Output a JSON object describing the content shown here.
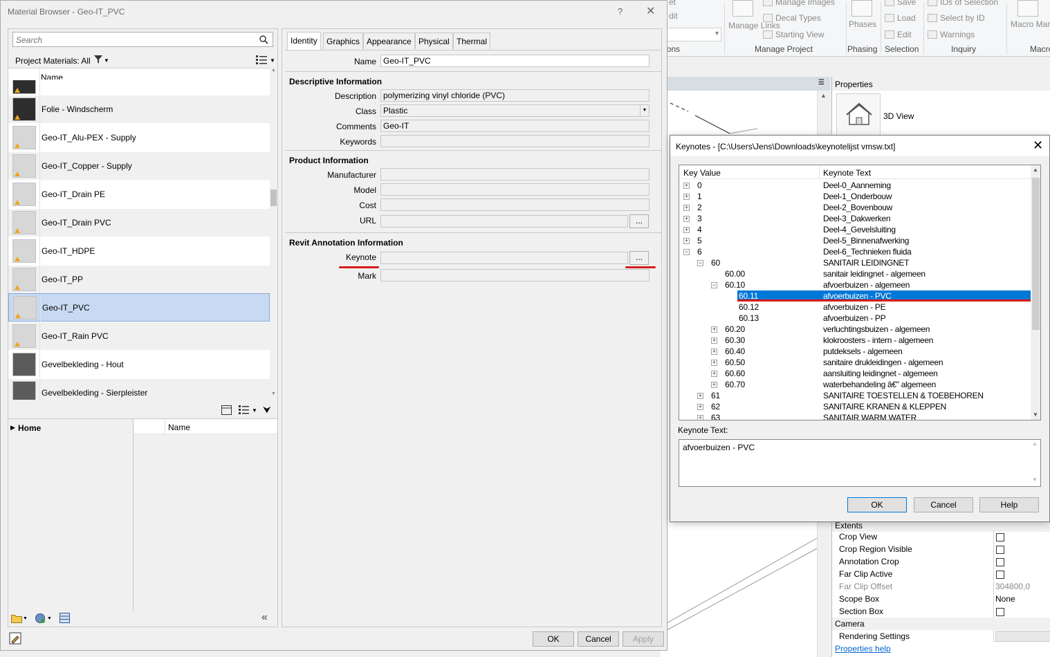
{
  "revit": {
    "ribbon": {
      "items": [
        "Save",
        "Load",
        "Edit",
        "Manage Images",
        "Decal Types",
        "Starting View",
        "IDs of Selection",
        "Select by ID",
        "Warnings",
        "Phases",
        "Manage Links",
        "Macro Manager"
      ],
      "groups": [
        "ions",
        "Manage Project",
        "Phasing",
        "Selection",
        "Inquiry",
        "Macro"
      ],
      "left_fragment": [
        "et",
        "dit"
      ]
    },
    "properties": {
      "title": "Properties",
      "type_name": "3D View",
      "categories": [
        "Extents",
        "Camera"
      ],
      "rows": [
        {
          "name": "Crop View",
          "checkbox": true
        },
        {
          "name": "Crop Region Visible",
          "checkbox": true
        },
        {
          "name": "Annotation Crop",
          "checkbox": true
        },
        {
          "name": "Far Clip Active",
          "checkbox": true
        },
        {
          "name": "Far Clip Offset",
          "value": "304800,0"
        },
        {
          "name": "Scope Box",
          "value": "None"
        },
        {
          "name": "Section Box",
          "checkbox": true
        },
        {
          "name": "Rendering Settings"
        }
      ],
      "help_link": "Properties help"
    }
  },
  "material_browser": {
    "title": "Material Browser - Geo-IT_PVC",
    "help": "?",
    "close": "✕",
    "search_placeholder": "Search",
    "filter_label": "Project Materials: All",
    "list_header": "Name",
    "materials": [
      {
        "name": "",
        "thumb": "dark"
      },
      {
        "name": "Folie - Windscherm",
        "thumb": "dark"
      },
      {
        "name": "Geo-IT_Alu-PEX - Supply",
        "thumb": "grey"
      },
      {
        "name": "Geo-IT_Copper - Supply",
        "thumb": "grey"
      },
      {
        "name": "Geo-IT_Drain PE",
        "thumb": "grey"
      },
      {
        "name": "Geo-IT_Drain PVC",
        "thumb": "grey"
      },
      {
        "name": "Geo-IT_HDPE",
        "thumb": "grey"
      },
      {
        "name": "Geo-IT_PP",
        "thumb": "grey"
      },
      {
        "name": "Geo-IT_PVC",
        "thumb": "grey",
        "selected": true
      },
      {
        "name": "Geo-IT_Rain PVC",
        "thumb": "grey"
      },
      {
        "name": "Gevelbekleding - Hout",
        "thumb": "tex"
      },
      {
        "name": "Gevelbekleding - Sierpleister",
        "thumb": "tex"
      }
    ],
    "library": {
      "tree_root": "Home",
      "list_header": "Name"
    },
    "tabs": [
      "Identity",
      "Graphics",
      "Appearance",
      "Physical",
      "Thermal"
    ],
    "active_tab": "Identity",
    "fields": {
      "name": {
        "label": "Name",
        "value": "Geo-IT_PVC"
      },
      "descriptive_header": "Descriptive Information",
      "description": {
        "label": "Description",
        "value": "polymerizing vinyl chloride (PVC)"
      },
      "class": {
        "label": "Class",
        "value": "Plastic"
      },
      "comments": {
        "label": "Comments",
        "value": "Geo-IT"
      },
      "keywords": {
        "label": "Keywords",
        "value": ""
      },
      "product_header": "Product Information",
      "manufacturer": {
        "label": "Manufacturer",
        "value": ""
      },
      "model": {
        "label": "Model",
        "value": ""
      },
      "cost": {
        "label": "Cost",
        "value": ""
      },
      "url": {
        "label": "URL",
        "value": ""
      },
      "revit_header": "Revit Annotation Information",
      "keynote": {
        "label": "Keynote",
        "value": ""
      },
      "mark": {
        "label": "Mark",
        "value": ""
      }
    },
    "browse_button": "...",
    "buttons": {
      "ok": "OK",
      "cancel": "Cancel",
      "apply": "Apply"
    }
  },
  "keynotes": {
    "title": "Keynotes - [C:\\Users\\Jens\\Downloads\\keynotelijst vmsw.txt]",
    "close": "✕",
    "col_key": "Key Value",
    "col_text": "Keynote Text",
    "rows": [
      {
        "key": "0",
        "text": "Deel-0_Aanneming",
        "level": 0,
        "exp": "+"
      },
      {
        "key": "1",
        "text": "Deel-1_Onderbouw",
        "level": 0,
        "exp": "+"
      },
      {
        "key": "2",
        "text": "Deel-2_Bovenbouw",
        "level": 0,
        "exp": "+"
      },
      {
        "key": "3",
        "text": "Deel-3_Dakwerken",
        "level": 0,
        "exp": "+"
      },
      {
        "key": "4",
        "text": "Deel-4_Gevelsluiting",
        "level": 0,
        "exp": "+"
      },
      {
        "key": "5",
        "text": "Deel-5_Binnenafwerking",
        "level": 0,
        "exp": "+"
      },
      {
        "key": "6",
        "text": "Deel-6_Technieken fluida",
        "level": 0,
        "exp": "−"
      },
      {
        "key": "60",
        "text": "SANITAIR LEIDINGNET",
        "level": 1,
        "exp": "−"
      },
      {
        "key": "60.00",
        "text": "sanitair leidingnet - algemeen",
        "level": 2,
        "exp": ""
      },
      {
        "key": "60.10",
        "text": "afvoerbuizen - algemeen",
        "level": 2,
        "exp": "−"
      },
      {
        "key": "60.11",
        "text": "afvoerbuizen - PVC",
        "level": 3,
        "exp": "",
        "selected": true
      },
      {
        "key": "60.12",
        "text": "afvoerbuizen - PE",
        "level": 3,
        "exp": ""
      },
      {
        "key": "60.13",
        "text": "afvoerbuizen - PP",
        "level": 3,
        "exp": ""
      },
      {
        "key": "60.20",
        "text": "verluchtingsbuizen - algemeen",
        "level": 2,
        "exp": "+"
      },
      {
        "key": "60.30",
        "text": "klokroosters - intern - algemeen",
        "level": 2,
        "exp": "+"
      },
      {
        "key": "60.40",
        "text": "putdeksels - algemeen",
        "level": 2,
        "exp": "+"
      },
      {
        "key": "60.50",
        "text": "sanitaire drukleidingen - algemeen",
        "level": 2,
        "exp": "+"
      },
      {
        "key": "60.60",
        "text": "aansluiting leidingnet - algemeen",
        "level": 2,
        "exp": "+"
      },
      {
        "key": "60.70",
        "text": "waterbehandeling â€\" algemeen",
        "level": 2,
        "exp": "+"
      },
      {
        "key": "61",
        "text": "SANITAIRE TOESTELLEN & TOEBEHOREN",
        "level": 1,
        "exp": "+"
      },
      {
        "key": "62",
        "text": "SANITAIRE KRANEN & KLEPPEN",
        "level": 1,
        "exp": "+"
      },
      {
        "key": "63",
        "text": "SANITAIR WARM WATER",
        "level": 1,
        "exp": "+"
      }
    ],
    "text_label": "Keynote Text:",
    "text_value": "afvoerbuizen - PVC",
    "buttons": {
      "ok": "OK",
      "cancel": "Cancel",
      "help": "Help"
    },
    "accent_color": "#0078d7",
    "highlight_color": "#d81c1c"
  }
}
